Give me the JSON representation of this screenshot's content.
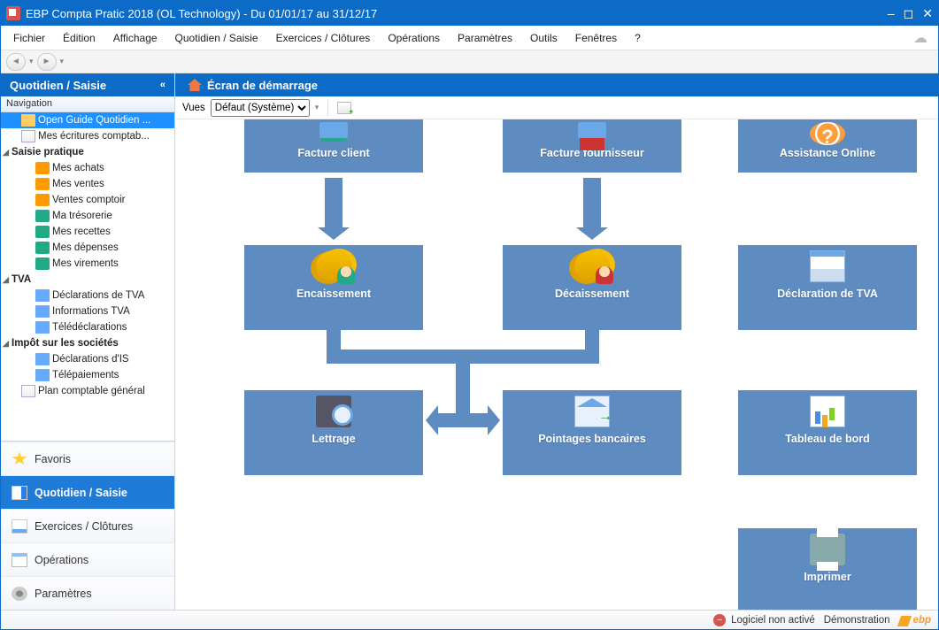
{
  "title": "EBP Compta Pratic 2018 (OL Technology) - Du 01/01/17 au 31/12/17",
  "menu": [
    "Fichier",
    "Édition",
    "Affichage",
    "Quotidien / Saisie",
    "Exercices / Clôtures",
    "Opérations",
    "Paramètres",
    "Outils",
    "Fenêtres",
    "?"
  ],
  "sidebar": {
    "header": "Quotidien / Saisie",
    "nav_label": "Navigation",
    "tree": {
      "open_guide": "Open Guide Quotidien ...",
      "ecritures": "Mes écritures comptab...",
      "saisie_pratique": "Saisie pratique",
      "achats": "Mes achats",
      "ventes": "Mes ventes",
      "comptoir": "Ventes comptoir",
      "tresorerie": "Ma trésorerie",
      "recettes": "Mes recettes",
      "depenses": "Mes dépenses",
      "virements": "Mes virements",
      "tva": "TVA",
      "decl_tva": "Déclarations de TVA",
      "info_tva": "Informations TVA",
      "teledecl": "Télédéclarations",
      "impot": "Impôt sur les sociétés",
      "decl_is": "Déclarations d'IS",
      "telepay": "Télépaiements",
      "plan": "Plan comptable général"
    },
    "panels": {
      "favoris": "Favoris",
      "quotidien": "Quotidien / Saisie",
      "exercices": "Exercices / Clôtures",
      "operations": "Opérations",
      "parametres": "Paramètres"
    }
  },
  "content": {
    "header": "Écran de démarrage",
    "vues_label": "Vues",
    "vues_value": "Défaut (Système)",
    "tiles": {
      "facture_client": "Facture client",
      "facture_fournisseur": "Facture fournisseur",
      "assistance": "Assistance Online",
      "encaissement": "Encaissement",
      "decaissement": "Décaissement",
      "decl_tva": "Déclaration de TVA",
      "lettrage": "Lettrage",
      "pointages": "Pointages bancaires",
      "tableau": "Tableau de bord",
      "imprimer": "Imprimer"
    }
  },
  "status": {
    "not_activated": "Logiciel non activé",
    "demo": "Démonstration",
    "brand": "ebp"
  }
}
